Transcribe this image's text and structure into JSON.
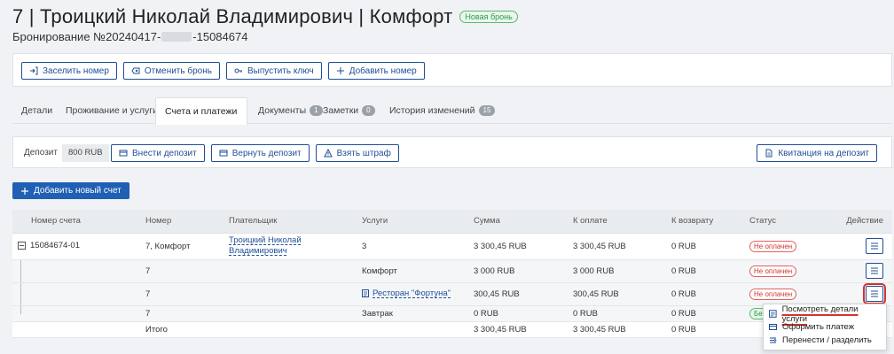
{
  "header": {
    "title": "7 | Троицкий Николай Владимирович | Комфорт",
    "badge": "Новая бронь",
    "booking_prefix": "Бронирование №20240417-",
    "booking_suffix": "-15084674"
  },
  "toolbar": {
    "checkin": "Заселить номер",
    "cancel": "Отменить бронь",
    "key": "Выпустить ключ",
    "add_room": "Добавить номер"
  },
  "tabs": [
    {
      "label": "Детали"
    },
    {
      "label": "Проживание и услуги"
    },
    {
      "label": "Счета и платежи"
    },
    {
      "label": "Документы",
      "count": "1"
    },
    {
      "label": "Заметки",
      "count": "0"
    },
    {
      "label": "История изменений",
      "count": "15"
    }
  ],
  "deposit": {
    "label": "Депозит",
    "amount": "800 RUB",
    "add": "Внести депозит",
    "return": "Вернуть депозит",
    "fine": "Взять штраф",
    "receipt": "Квитанция на депозит"
  },
  "add_account": "Добавить новый счет",
  "table": {
    "headers": [
      "Номер счета",
      "Номер",
      "Плательщик",
      "Услуги",
      "Сумма",
      "К оплате",
      "К возврату",
      "Статус",
      "Действие"
    ],
    "main_row": {
      "account": "15084674-01",
      "room": "7, Комфорт",
      "payer": "Троицкий Николай Владимирович",
      "services": "3",
      "sum": "3 300,45 RUB",
      "to_pay": "3 300,45 RUB",
      "refund": "0 RUB",
      "status": "Не оплачен"
    },
    "sub_rows": [
      {
        "room": "7",
        "service": "Комфорт",
        "sum": "3 000 RUB",
        "to_pay": "3 000 RUB",
        "refund": "0 RUB",
        "status": "Не оплачен"
      },
      {
        "room": "7",
        "service": "Ресторан \"Фортуна\"",
        "sum": "300,45 RUB",
        "to_pay": "300,45 RUB",
        "refund": "0 RUB",
        "status": "Не оплачен"
      },
      {
        "room": "7",
        "service": "Завтрак",
        "sum": "0 RUB",
        "to_pay": "0 RUB",
        "refund": "0 RUB",
        "status": "Бе"
      }
    ],
    "total": {
      "label": "Итого",
      "sum": "3 300,45 RUB",
      "to_pay": "3 300,45 RUB",
      "refund": "0 RUB"
    }
  },
  "menu": {
    "details": "Посмотреть детали услуги",
    "pay": "Оформить платеж",
    "move": "Перенести / разделить"
  },
  "colors": {
    "accent": "#1f4f96",
    "unpaid": "#d0342c",
    "paid": "#2e9a4a"
  }
}
